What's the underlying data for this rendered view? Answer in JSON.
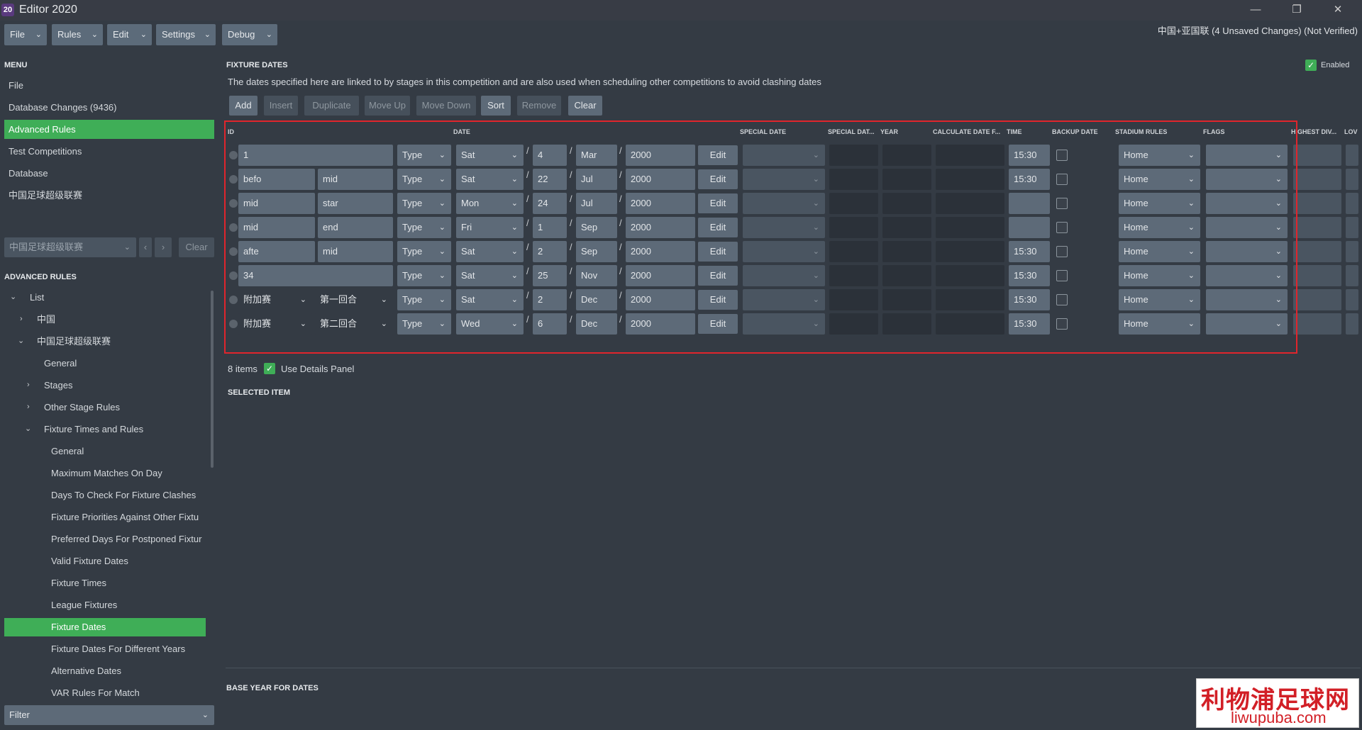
{
  "window": {
    "logo": "20",
    "title": "Editor 2020",
    "status": "中国+亚国联 (4 Unsaved Changes) (Not Verified)"
  },
  "menubar": [
    "File",
    "Rules",
    "Edit",
    "Settings",
    "Debug"
  ],
  "sidebar": {
    "menu_heading": "MENU",
    "menu_items": [
      "File",
      "Database Changes (9436)",
      "Advanced Rules",
      "Test Competitions",
      "Database",
      "中国足球超级联赛"
    ],
    "competition_select": "中国足球超级联赛",
    "clear_label": "Clear",
    "advanced_rules_heading": "ADVANCED RULES",
    "tree": [
      "List",
      "中国",
      "中国足球超级联赛",
      "General",
      "Stages",
      "Other Stage Rules",
      "Fixture Times and Rules",
      "General",
      "Maximum Matches On Day",
      "Days To Check For Fixture Clashes",
      "Fixture Priorities Against Other Fixtu",
      "Preferred Days For Postponed Fixtur",
      "Valid Fixture Dates",
      "Fixture Times",
      "League Fixtures",
      "Fixture Dates",
      "Fixture Dates For Different Years",
      "Alternative Dates",
      "VAR Rules For Match"
    ],
    "filter_label": "Filter"
  },
  "fixture_dates": {
    "heading": "FIXTURE DATES",
    "description": "The dates specified here are linked to by stages in this competition and are also used when scheduling other competitions to avoid clashing dates",
    "enabled_label": "Enabled",
    "toolbar": [
      "Add",
      "Insert",
      "Duplicate",
      "Move Up",
      "Move Down",
      "Sort",
      "Remove",
      "Clear"
    ],
    "columns": {
      "id": "ID",
      "date": "DATE",
      "special_date": "SPECIAL DATE",
      "special_dat": "SPECIAL DAT...",
      "year": "YEAR",
      "calculate": "CALCULATE DATE F...",
      "time": "TIME",
      "backup": "BACKUP DATE",
      "stadium": "STADIUM RULES",
      "flags": "FLAGS",
      "highest": "HIGHEST DIV...",
      "low": "LOV"
    },
    "type_label": "Type",
    "edit_label": "Edit",
    "rows": [
      {
        "id_a": "1",
        "id_b": "",
        "day": "Sat",
        "date": "4",
        "month": "Mar",
        "year": "2000",
        "time": "15:30",
        "stadium": "Home"
      },
      {
        "id_a": "befo",
        "id_b": "mid",
        "day": "Sat",
        "date": "22",
        "month": "Jul",
        "year": "2000",
        "time": "15:30",
        "stadium": "Home"
      },
      {
        "id_a": "mid",
        "id_b": "star",
        "day": "Mon",
        "date": "24",
        "month": "Jul",
        "year": "2000",
        "time": "",
        "stadium": "Home"
      },
      {
        "id_a": "mid",
        "id_b": "end",
        "day": "Fri",
        "date": "1",
        "month": "Sep",
        "year": "2000",
        "time": "",
        "stadium": "Home"
      },
      {
        "id_a": "afte",
        "id_b": "mid",
        "day": "Sat",
        "date": "2",
        "month": "Sep",
        "year": "2000",
        "time": "15:30",
        "stadium": "Home"
      },
      {
        "id_a": "34",
        "id_b": "",
        "day": "Sat",
        "date": "25",
        "month": "Nov",
        "year": "2000",
        "time": "15:30",
        "stadium": "Home"
      },
      {
        "id_a": "附加赛",
        "id_b": "第一回合",
        "day": "Sat",
        "date": "2",
        "month": "Dec",
        "year": "2000",
        "time": "15:30",
        "stadium": "Home"
      },
      {
        "id_a": "附加赛",
        "id_b": "第二回合",
        "day": "Wed",
        "date": "6",
        "month": "Dec",
        "year": "2000",
        "time": "15:30",
        "stadium": "Home"
      }
    ],
    "items_count": "8 items",
    "use_details_label": "Use Details Panel",
    "selected_item_heading": "SELECTED ITEM",
    "base_year_heading": "BASE YEAR FOR DATES"
  },
  "watermark": {
    "line1": "利物浦足球网",
    "line2": "liwupuba.com"
  }
}
